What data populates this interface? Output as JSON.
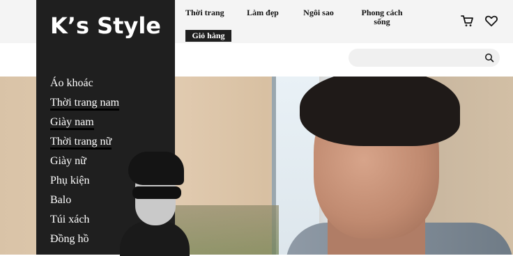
{
  "brand": {
    "name": "K’s Style"
  },
  "top_nav": {
    "items": [
      "Thời trang",
      "Làm đẹp",
      "Ngôi sao",
      "Phong cách sống"
    ],
    "cart_label": "Giỏ hàng"
  },
  "header_icons": [
    "cart-icon",
    "heart-icon"
  ],
  "search": {
    "placeholder": "",
    "value": "",
    "icon": "search-icon"
  },
  "sidebar": {
    "items": [
      {
        "label": "Áo khoác"
      },
      {
        "label": "Thời trang nam"
      },
      {
        "label": "Giày nam"
      },
      {
        "label": "Thời trang nữ"
      },
      {
        "label": "Giày nữ"
      },
      {
        "label": "Phụ kiện"
      },
      {
        "label": "Balo"
      },
      {
        "label": "Túi xách"
      },
      {
        "label": "Đồng hồ"
      }
    ]
  },
  "colors": {
    "panel": "#1f1f1f",
    "topbar": "#f4f4f4",
    "text_light": "#ffffff"
  }
}
